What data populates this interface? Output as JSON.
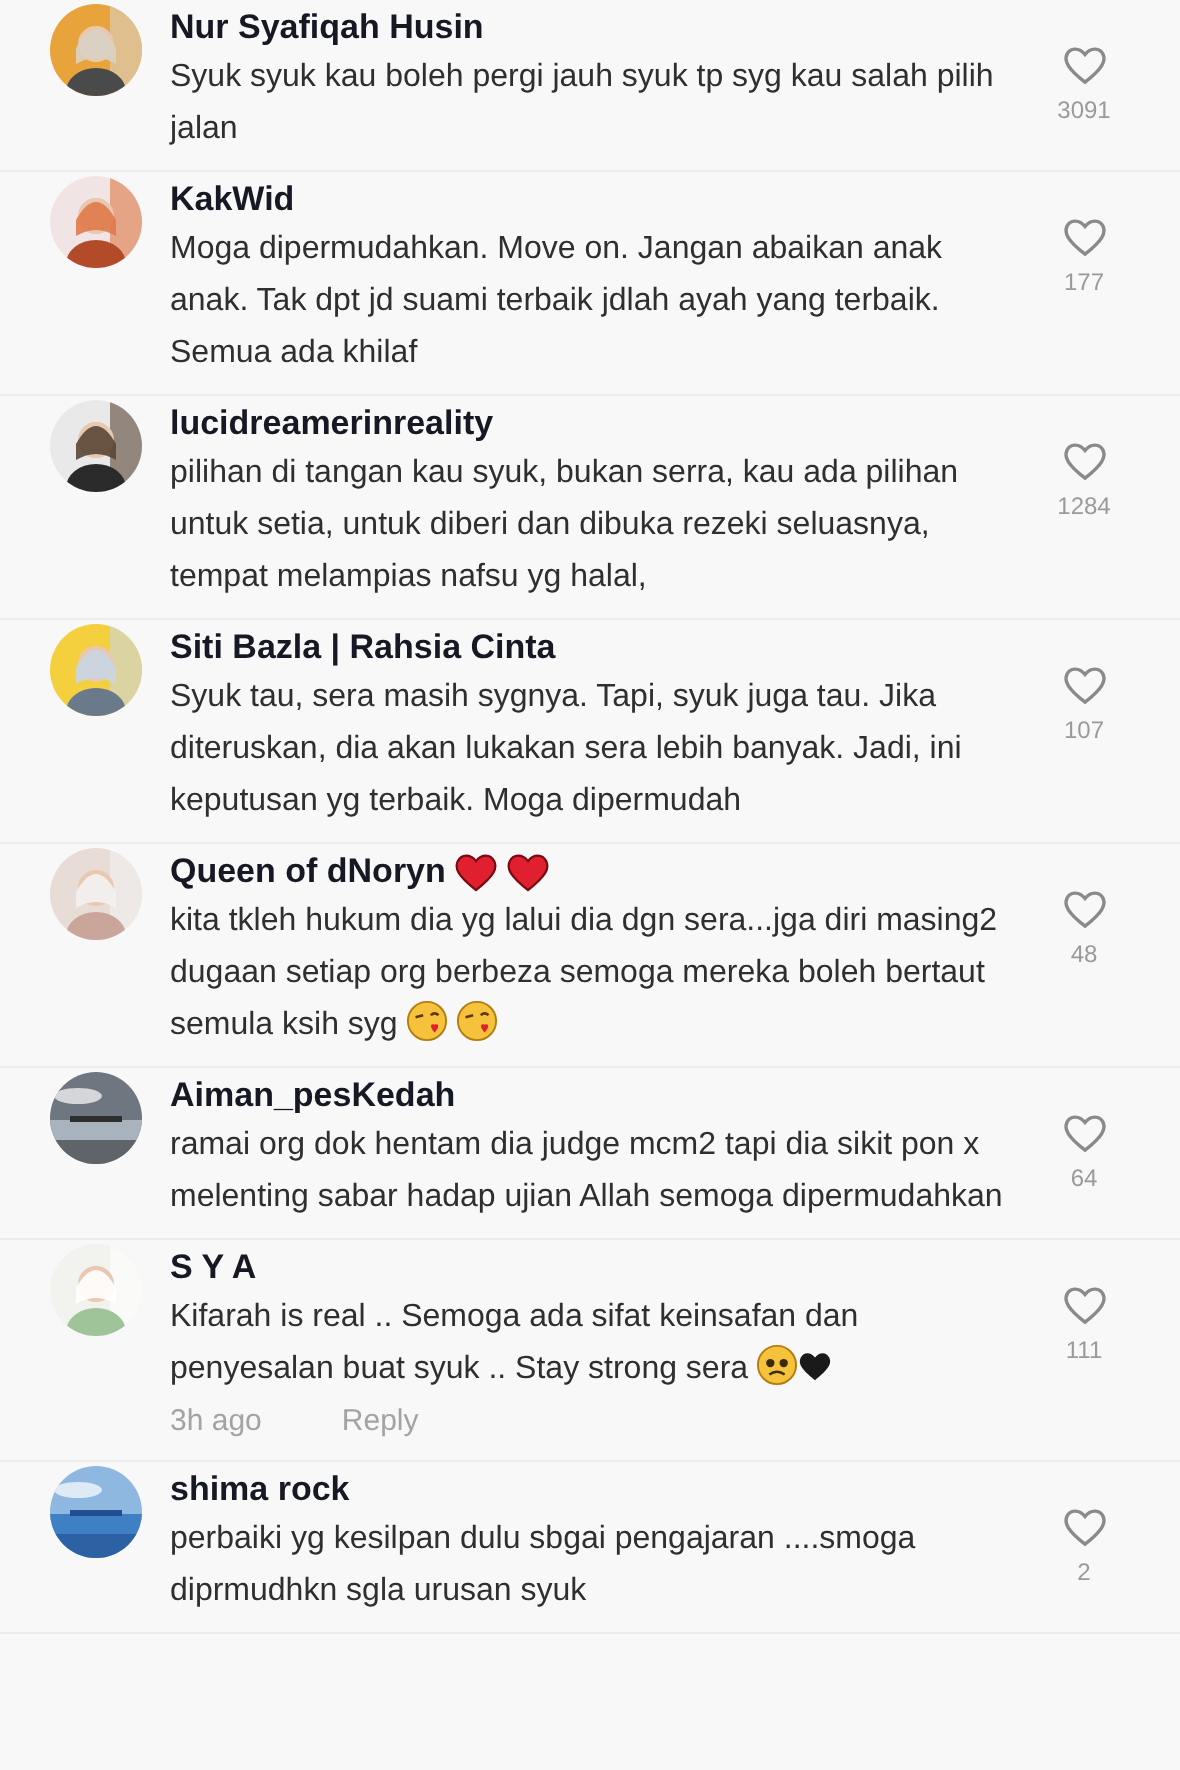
{
  "comments": [
    {
      "name": "Nur Syafiqah Husin",
      "text": "Syuk syuk kau boleh pergi jauh syuk tp syg kau salah pilih jalan",
      "likes": "3091"
    },
    {
      "name": "KakWid",
      "text": "Moga dipermudahkan. Move on. Jangan abaikan anak anak. Tak dpt jd suami terbaik jdlah ayah yang terbaik. Semua ada khilaf",
      "likes": "177"
    },
    {
      "name": "lucidreamerinreality",
      "text": "pilihan di tangan kau syuk, bukan serra, kau ada pilihan untuk setia, untuk diberi dan dibuka rezeki seluasnya, tempat melampias nafsu yg halal,",
      "likes": "1284"
    },
    {
      "name": "Siti Bazla | Rahsia Cinta",
      "text": "Syuk tau, sera masih sygnya. Tapi, syuk juga tau. Jika diteruskan, dia akan lukakan sera lebih banyak. Jadi, ini keputusan yg terbaik. Moga dipermudah",
      "likes": "107"
    },
    {
      "name": "Queen of dNoryn",
      "name_icons": [
        {
          "kind": "red_heart"
        },
        {
          "kind": "red_heart"
        }
      ],
      "text": "kita tkleh hukum dia yg lalui dia dgn sera...jga diri masing2 dugaan setiap org berbeza semoga mereka boleh bertaut semula ksih syg",
      "text_icons": [
        {
          "kind": "kiss"
        },
        {
          "kind": "kiss"
        }
      ],
      "likes": "48"
    },
    {
      "name": "Aiman_pesKedah",
      "text": "ramai org dok hentam dia judge mcm2 tapi dia sikit pon x melenting sabar hadap ujian Allah semoga dipermudahkan",
      "likes": "64"
    },
    {
      "name": "S Y A",
      "text": "Kifarah is real .. Semoga ada sifat keinsafan dan penyesalan buat syuk .. Stay strong sera",
      "text_icons": [
        {
          "kind": "sad"
        },
        {
          "kind": "black_heart"
        }
      ],
      "likes": "111",
      "time": "3h ago",
      "reply": "Reply"
    },
    {
      "name": "shima rock",
      "text": "perbaiki yg kesilpan dulu sbgai pengajaran ....smoga diprmudhkn sgla urusan syuk",
      "likes": "2"
    }
  ]
}
